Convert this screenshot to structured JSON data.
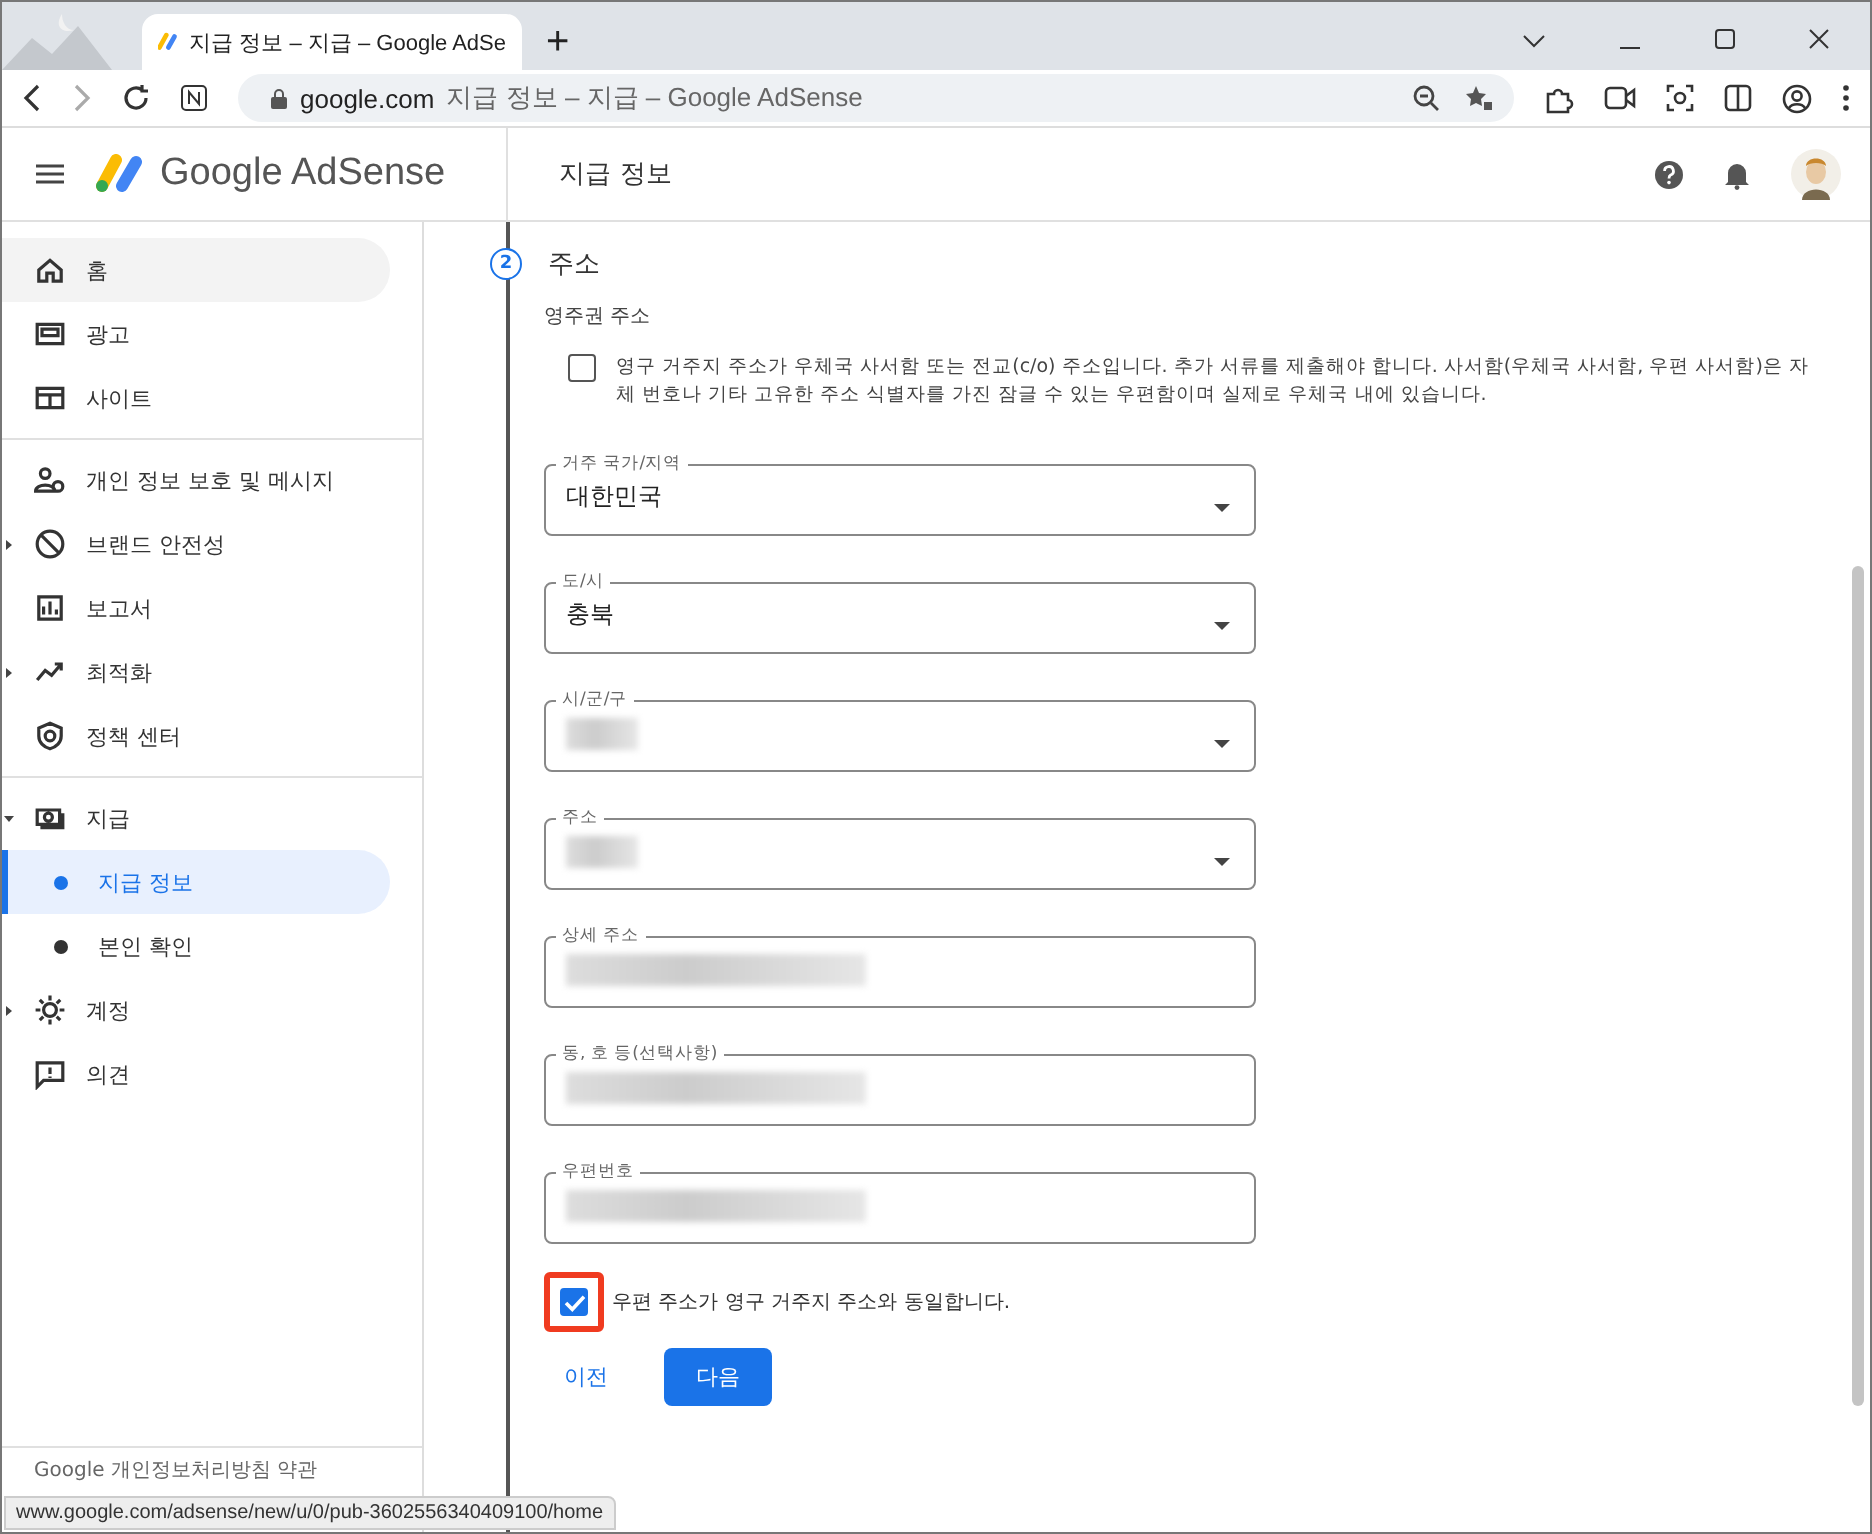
{
  "browser": {
    "tab_title": "지급 정보 – 지급 – Google AdSe",
    "new_tab": "+",
    "url_host": "google.com",
    "url_title": "지급 정보 – 지급 – Google AdSense",
    "status_url": "www.google.com/adsense/new/u/0/pub-3602556340409100/home"
  },
  "header": {
    "product": "Google AdSense",
    "page_title": "지급 정보"
  },
  "sidebar": {
    "sections": [
      [
        {
          "label": "홈",
          "selected": false,
          "hover": true,
          "expandable": false
        },
        {
          "label": "광고",
          "selected": false,
          "hover": false,
          "expandable": false
        },
        {
          "label": "사이트",
          "selected": false,
          "hover": false,
          "expandable": false
        }
      ],
      [
        {
          "label": "개인 정보 보호 및 메시지",
          "selected": false,
          "hover": false,
          "expandable": false
        },
        {
          "label": "브랜드 안전성",
          "selected": false,
          "hover": false,
          "expandable": true
        },
        {
          "label": "보고서",
          "selected": false,
          "hover": false,
          "expandable": false
        },
        {
          "label": "최적화",
          "selected": false,
          "hover": false,
          "expandable": true
        },
        {
          "label": "정책 센터",
          "selected": false,
          "hover": false,
          "expandable": false
        }
      ],
      [
        {
          "label": "지급",
          "selected": false,
          "hover": false,
          "expandable": true,
          "expanded": true,
          "children": [
            {
              "label": "지급 정보",
              "selected": true
            },
            {
              "label": "본인 확인",
              "selected": false
            }
          ]
        },
        {
          "label": "계정",
          "selected": false,
          "hover": false,
          "expandable": true,
          "expanded": false
        },
        {
          "label": "의견",
          "selected": false,
          "hover": false,
          "expandable": false
        }
      ]
    ],
    "footer": "Google  개인정보처리방침  약관"
  },
  "step": {
    "number": "2",
    "title": "주소",
    "subtitle": "영주권 주소"
  },
  "po_box": {
    "checked": false,
    "text": "영구 거주지 주소가 우체국 사서함 또는 전교(c/o) 주소입니다. 추가 서류를 제출해야 합니다. 사서함(우체국 사서함, 우편 사서함)은 자체 번호나 기타 고유한 주소 식별자를 가진 잠글 수 있는 우편함이며 실제로 우체국 내에 있습니다."
  },
  "fields": [
    {
      "label": "거주 국가/지역",
      "kind": "select",
      "value": "대한민국",
      "redacted": false
    },
    {
      "label": "도/시",
      "kind": "select",
      "value": "충북",
      "redacted": false
    },
    {
      "label": "시/군/구",
      "kind": "select",
      "redacted": true
    },
    {
      "label": "주소",
      "kind": "select",
      "redacted": true
    },
    {
      "label": "상세 주소",
      "kind": "text",
      "redacted": true
    },
    {
      "label": "동, 호 등(선택사항)",
      "kind": "text",
      "redacted": true
    },
    {
      "label": "우편번호",
      "kind": "text",
      "redacted": true
    }
  ],
  "same_address": {
    "checked": true,
    "highlighted": true,
    "text": "우편 주소가 영구 거주지 주소와 동일합니다."
  },
  "buttons": {
    "back": "이전",
    "next": "다음"
  }
}
